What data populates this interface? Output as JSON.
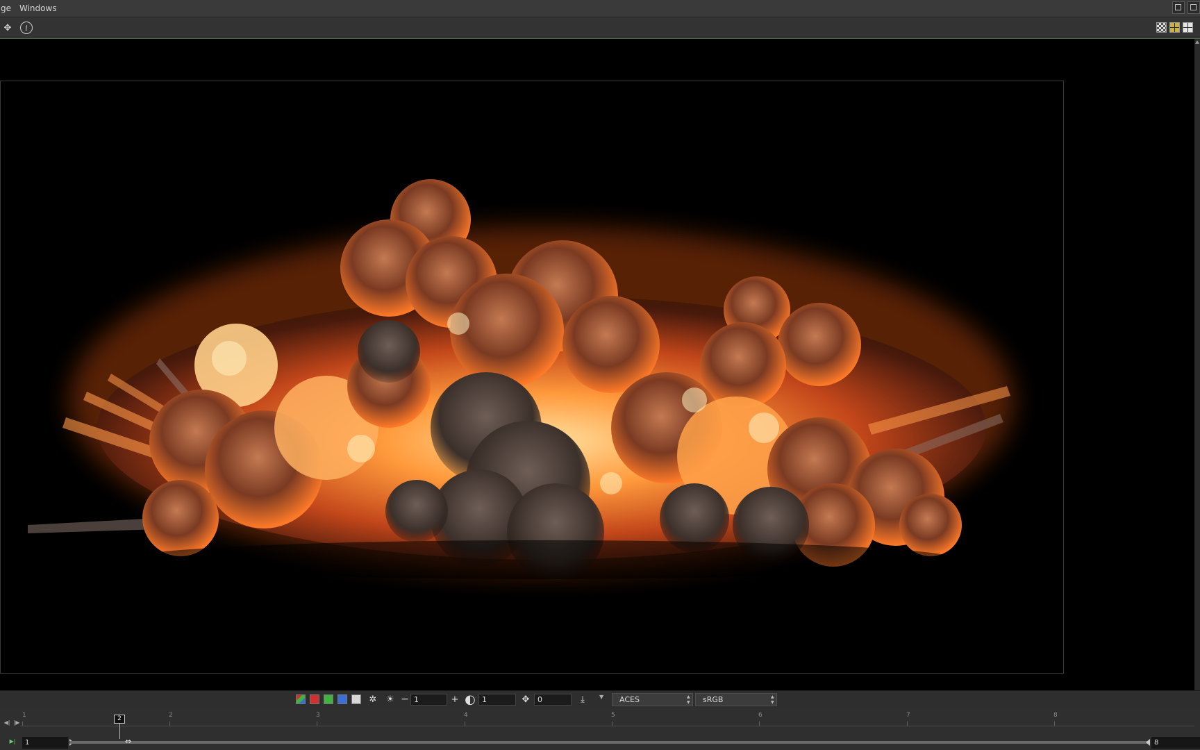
{
  "menubar": {
    "items": [
      "ge",
      "Windows"
    ]
  },
  "viewer": {
    "exposure_value": "1",
    "gamma_value": "1",
    "offset_value": "0",
    "display_colorspace": "ACES",
    "view_transform": "sRGB"
  },
  "timeline": {
    "tick_labels": [
      "1",
      "2",
      "3",
      "4",
      "5",
      "6",
      "7",
      "8"
    ],
    "current_frame": "2",
    "range_start": "1",
    "range_end": "8"
  },
  "colors": {
    "accent": "#c9b24a",
    "red_channel": "#d23030",
    "green_channel": "#3fb23f",
    "blue_channel": "#3a6fd8"
  }
}
